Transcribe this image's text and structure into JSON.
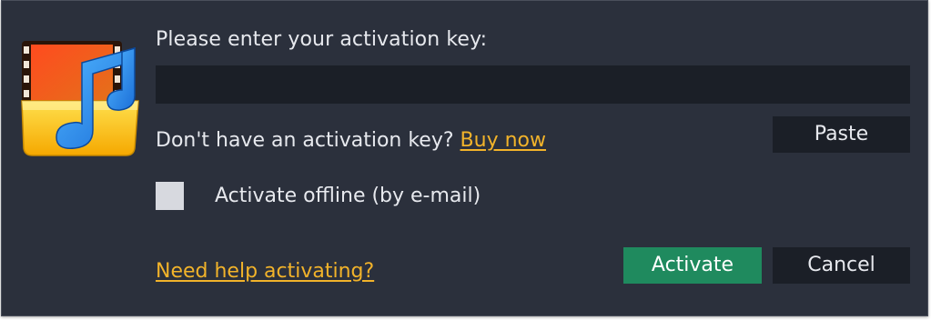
{
  "dialog": {
    "prompt": "Please enter your activation key:",
    "key_input": {
      "value": "",
      "placeholder": ""
    },
    "no_key_text": "Don't have an activation key?",
    "buy_now_link": "Buy now",
    "paste_button": "Paste",
    "offline_checkbox": {
      "checked": false,
      "label": "Activate offline (by e-mail)"
    },
    "help_link": "Need help activating?",
    "activate_button": "Activate",
    "cancel_button": "Cancel",
    "icon": "movavi-music-folder-icon"
  },
  "colors": {
    "background": "#2b303c",
    "input_background": "#1b1f27",
    "link": "#f2b32a",
    "activate": "#1f8a5e",
    "text": "#e7e9ee"
  }
}
